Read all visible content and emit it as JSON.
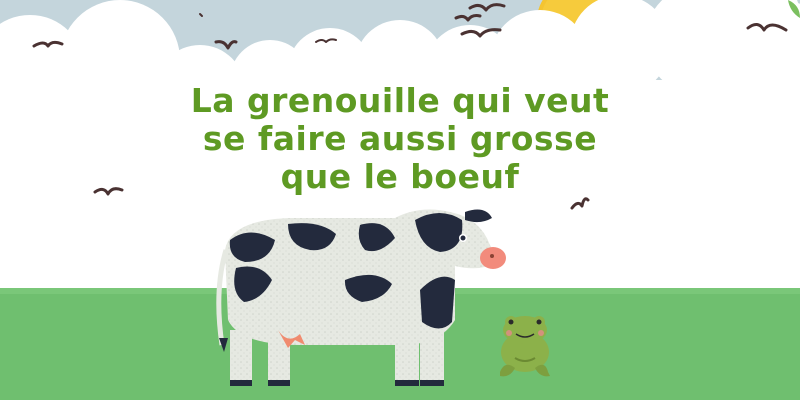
{
  "title": {
    "line1": "La grenouille qui veut",
    "line2": "se faire aussi grosse",
    "line3": "que le boeuf"
  },
  "colors": {
    "sky": "#c4d5dc",
    "cloud": "#ffffff",
    "sun": "#f4c431",
    "grass": "#6fbf6f",
    "title": "#5e9a23",
    "cow_body": "#e6e9e2",
    "cow_spots": "#232a3d",
    "cow_nose": "#f28b7c",
    "frog": "#8cb14a",
    "bird": "#4a3232"
  },
  "icons": {
    "sun": "sun-icon",
    "bird": "bird-icon",
    "cow": "cow-illustration",
    "frog": "frog-illustration"
  }
}
